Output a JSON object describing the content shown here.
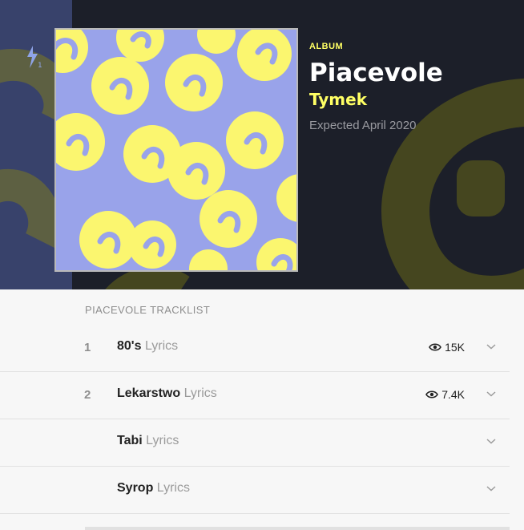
{
  "album": {
    "kind": "ALBUM",
    "title": "Piacevole",
    "artist": "Tymek",
    "release": "Expected April 2020"
  },
  "pin": {
    "count": "1",
    "icon": "lightning-bolt-icon"
  },
  "tracklist": {
    "heading": "PIACEVOLE TRACKLIST",
    "tracks": [
      {
        "number": "1",
        "name": "80's",
        "suffix": "Lyrics",
        "views": "15K"
      },
      {
        "number": "2",
        "name": "Lekarstwo",
        "suffix": "Lyrics",
        "views": "7.4K"
      },
      {
        "number": "",
        "name": "Tabi",
        "suffix": "Lyrics",
        "views": ""
      },
      {
        "number": "",
        "name": "Syrop",
        "suffix": "Lyrics",
        "views": ""
      }
    ]
  },
  "colors": {
    "accent_yellow": "#ffff64",
    "cover_bg": "#99a3ea",
    "hero_bg": "#1b1e28"
  }
}
